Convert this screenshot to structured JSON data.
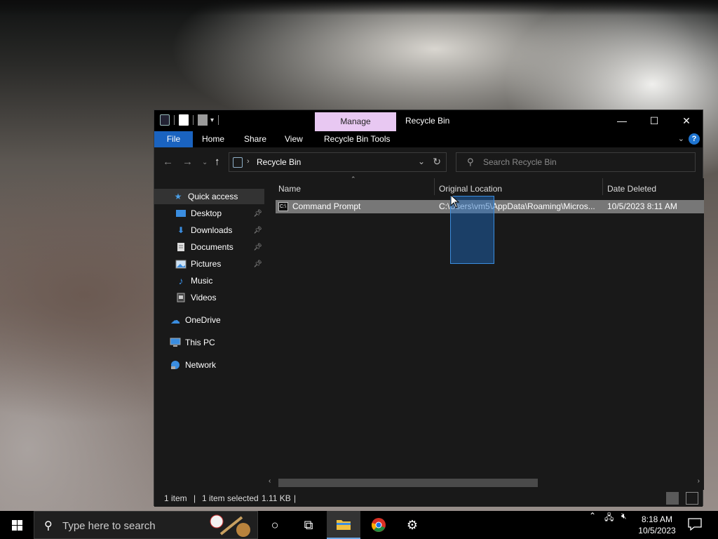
{
  "window": {
    "title": "Recycle Bin",
    "manage_tab": "Manage",
    "controls": {
      "minimize": "—",
      "maximize": "☐",
      "close": "✕"
    }
  },
  "ribbon": {
    "file": "File",
    "home": "Home",
    "share": "Share",
    "view": "View",
    "recycle_bin_tools": "Recycle Bin Tools",
    "help": "?"
  },
  "navigation": {
    "breadcrumb": "Recycle Bin",
    "search_placeholder": "Search Recycle Bin"
  },
  "sidebar": {
    "quick_access": "Quick access",
    "pinned": [
      {
        "label": "Desktop",
        "icon": "desktop-icon",
        "pinned": true
      },
      {
        "label": "Downloads",
        "icon": "downloads-icon",
        "pinned": true
      },
      {
        "label": "Documents",
        "icon": "documents-icon",
        "pinned": true
      },
      {
        "label": "Pictures",
        "icon": "pictures-icon",
        "pinned": true
      },
      {
        "label": "Music",
        "icon": "music-icon",
        "pinned": false
      },
      {
        "label": "Videos",
        "icon": "videos-icon",
        "pinned": false
      }
    ],
    "onedrive": "OneDrive",
    "this_pc": "This PC",
    "network": "Network"
  },
  "columns": {
    "name": "Name",
    "original_location": "Original Location",
    "date_deleted": "Date Deleted"
  },
  "files": [
    {
      "name": "Command Prompt",
      "original_location": "C:\\Users\\vm5\\AppData\\Roaming\\Micros...",
      "date_deleted": "10/5/2023 8:11 AM",
      "selected": true
    }
  ],
  "status": {
    "count": "1 item",
    "selected": "1 item selected",
    "size": "1.11 KB"
  },
  "taskbar": {
    "search_placeholder": "Type here to search",
    "time": "8:18 AM",
    "date": "10/5/2023"
  },
  "colors": {
    "accent": "#1a63c0",
    "manage_tab": "#e8c8f2",
    "selection": "#777777"
  }
}
